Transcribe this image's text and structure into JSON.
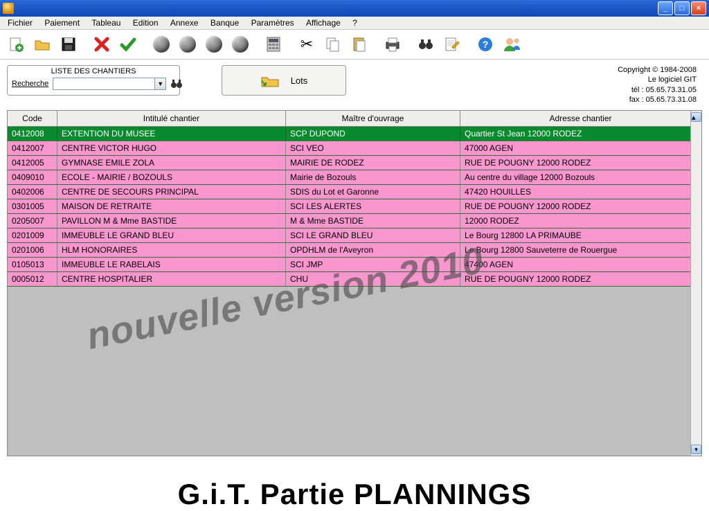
{
  "window": {
    "title": ""
  },
  "menu": [
    "Fichier",
    "Paiement",
    "Tableau",
    "Edition",
    "Annexe",
    "Banque",
    "Paramètres",
    "Affichage",
    "?"
  ],
  "search": {
    "panel_title": "LISTE DES CHANTIERS",
    "label": "Recherche",
    "value": "",
    "placeholder": ""
  },
  "lots_button": {
    "label": "Lots"
  },
  "copyright": {
    "line1": "Copyright © 1984-2008",
    "line2": "Le logiciel GIT",
    "line3": "tél : 05.65.73.31.05",
    "line4": "fax : 05.65.73.31.08"
  },
  "columns": {
    "code": "Code",
    "intitule": "Intitulé chantier",
    "maitre": "Maître d'ouvrage",
    "adresse": "Adresse chantier"
  },
  "rows": [
    {
      "code": "0412008",
      "intitule": "EXTENTION DU MUSEE",
      "maitre": "SCP DUPOND",
      "adresse": "Quartier St Jean 12000 RODEZ",
      "selected": true
    },
    {
      "code": "0412007",
      "intitule": "CENTRE  VICTOR HUGO",
      "maitre": "SCI VEO",
      "adresse": " 47000 AGEN"
    },
    {
      "code": "0412005",
      "intitule": "GYMNASE EMILE ZOLA",
      "maitre": "MAIRIE DE RODEZ",
      "adresse": "RUE DE POUGNY 12000 RODEZ"
    },
    {
      "code": "0409010",
      "intitule": "ECOLE - MAIRIE / BOZOULS",
      "maitre": "Mairie de Bozouls",
      "adresse": "Au centre du village 12000 Bozouls"
    },
    {
      "code": "0402006",
      "intitule": "CENTRE DE SECOURS PRINCIPAL",
      "maitre": "SDIS du Lot et Garonne",
      "adresse": " 47420 HOUILLES"
    },
    {
      "code": "0301005",
      "intitule": "MAISON DE RETRAITE",
      "maitre": "SCI LES ALERTES",
      "adresse": "RUE DE POUGNY 12000 RODEZ"
    },
    {
      "code": "0205007",
      "intitule": "PAVILLON M & Mme  BASTIDE",
      "maitre": "M & Mme  BASTIDE",
      "adresse": " 12000 RODEZ"
    },
    {
      "code": "0201009",
      "intitule": "IMMEUBLE LE GRAND BLEU",
      "maitre": "SCI LE GRAND BLEU",
      "adresse": "Le Bourg 12800 LA PRIMAUBE"
    },
    {
      "code": "0201006",
      "intitule": "HLM HONORAIRES",
      "maitre": "OPDHLM de l'Aveyron",
      "adresse": "Le Bourg 12800 Sauveterre de Rouergue"
    },
    {
      "code": "0105013",
      "intitule": "IMMEUBLE LE RABELAIS",
      "maitre": "SCI JMP",
      "adresse": " 47400 AGEN"
    },
    {
      "code": "0005012",
      "intitule": "CENTRE HOSPITALIER",
      "maitre": "CHU",
      "adresse": "RUE DE POUGNY 12000 RODEZ"
    }
  ],
  "watermark": "nouvelle version 2010",
  "bottom_title": "G.i.T. Partie PLANNINGS",
  "toolbar_icons": {
    "new": "new-icon",
    "open": "open-folder-icon",
    "save": "save-disk-icon",
    "delete": "delete-x-icon",
    "validate": "check-icon",
    "sphere1": "sphere-icon",
    "sphere2": "sphere-icon",
    "sphere3": "sphere-icon",
    "sphere4": "sphere-icon",
    "calc": "calculator-icon",
    "cut": "scissors-icon",
    "copy": "copy-icon",
    "paste": "paste-icon",
    "print": "printer-icon",
    "find": "binoculars-icon",
    "edit": "edit-note-icon",
    "help": "help-icon",
    "user": "user-support-icon"
  }
}
